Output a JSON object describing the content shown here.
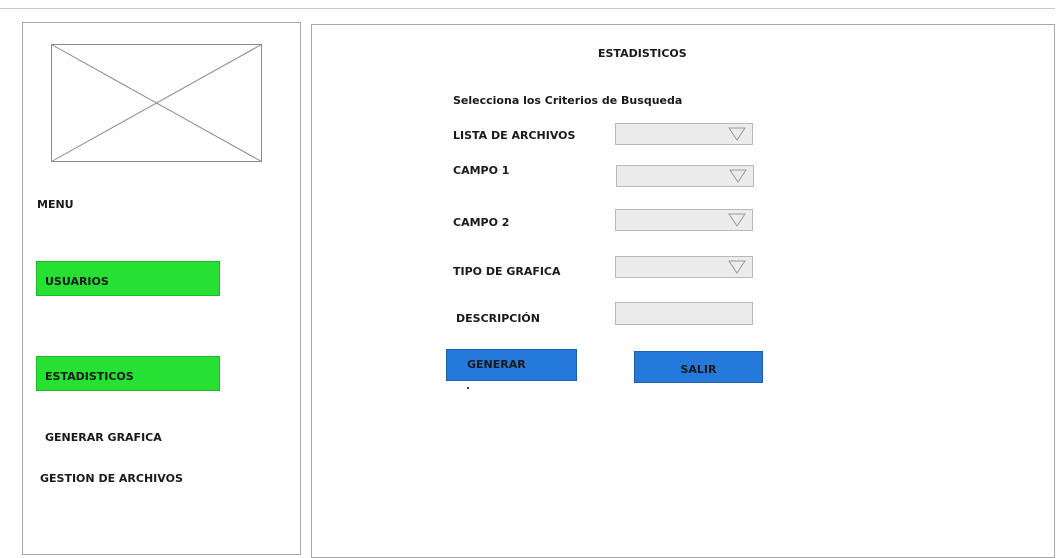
{
  "sidebar": {
    "logo_icon": "image-placeholder-icon",
    "menu_label": "MENU",
    "items": [
      {
        "label": "USUARIOS",
        "style": "green-button"
      },
      {
        "label": "ESTADISTICOS",
        "style": "green-button"
      },
      {
        "label": "GENERAR GRAFICA",
        "style": "text-link"
      },
      {
        "label": "GESTION DE  ARCHIVOS",
        "style": "text-link"
      }
    ]
  },
  "main": {
    "title": "ESTADISTICOS",
    "criteria_title": "Selecciona los Criterios de Busqueda",
    "fields": {
      "lista_archivos": {
        "label": "LISTA DE ARCHIVOS",
        "value": ""
      },
      "campo1": {
        "label": "CAMPO 1",
        "value": ""
      },
      "campo2": {
        "label": "CAMPO 2",
        "value": ""
      },
      "tipo_grafica": {
        "label": "TIPO DE GRAFICA",
        "value": ""
      },
      "descripcion": {
        "label": "DESCRIPCIÓN",
        "value": ""
      }
    },
    "buttons": {
      "generar": "GENERAR",
      "salir": "SALIR"
    }
  },
  "colors": {
    "nav_green": "#26e034",
    "button_blue": "#2479db",
    "field_gray": "#ececec"
  }
}
